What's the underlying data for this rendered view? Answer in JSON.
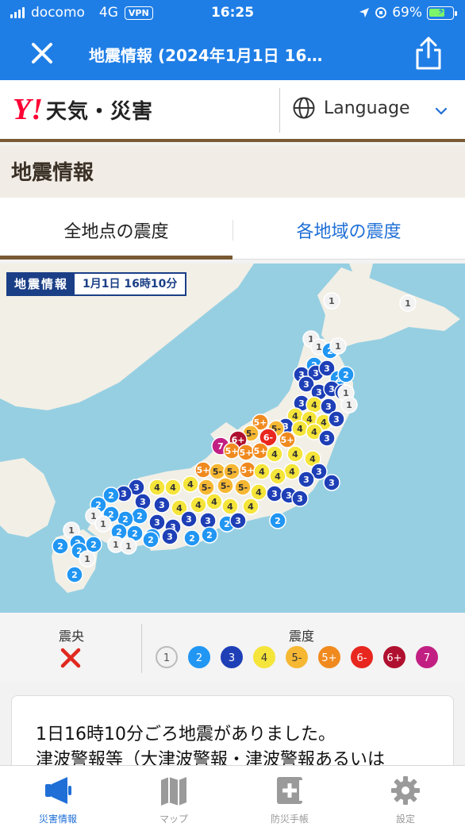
{
  "status_bar": {
    "carrier": "docomo",
    "network": "4G",
    "vpn": "VPN",
    "time": "16:25",
    "battery": "69%",
    "battery_level": 0.69
  },
  "navbar": {
    "title": "地震情報 (2024年1月1日 16…"
  },
  "brand": {
    "logo_mark": "Y!",
    "name": "天気・災害",
    "language_label": "Language"
  },
  "page": {
    "heading": "地震情報"
  },
  "tabs": [
    {
      "label": "全地点の震度",
      "active": true
    },
    {
      "label": "各地域の震度",
      "active": false
    }
  ],
  "map": {
    "badge_label": "地震情報",
    "badge_datetime": "1月1日 16時10分",
    "colors": {
      "sea": "#96cfe2",
      "land": "#f2efe6"
    }
  },
  "legend": {
    "epicenter_title": "震央",
    "intensity_title": "震度",
    "levels": [
      {
        "label": "1",
        "bg": "#f2f2f2",
        "fg": "#555555",
        "border": "#bbbbbb"
      },
      {
        "label": "2",
        "bg": "#2196f3",
        "fg": "#ffffff",
        "border": "#2196f3"
      },
      {
        "label": "3",
        "bg": "#1e3fb6",
        "fg": "#ffffff",
        "border": "#1e3fb6"
      },
      {
        "label": "4",
        "bg": "#f5e43a",
        "fg": "#333333",
        "border": "#f5e43a"
      },
      {
        "label": "5-",
        "bg": "#f6b733",
        "fg": "#333333",
        "border": "#f6b733"
      },
      {
        "label": "5+",
        "bg": "#f08a1f",
        "fg": "#ffffff",
        "border": "#f08a1f"
      },
      {
        "label": "6-",
        "bg": "#e8271f",
        "fg": "#ffffff",
        "border": "#e8271f"
      },
      {
        "label": "6+",
        "bg": "#b0102f",
        "fg": "#ffffff",
        "border": "#b0102f"
      },
      {
        "label": "7",
        "bg": "#c21f83",
        "fg": "#ffffff",
        "border": "#c21f83"
      }
    ]
  },
  "summary": {
    "line1": "1日16時10分ごろ地震がありました。",
    "line2": "津波警報等（大津波警報・津波警報あるいは"
  },
  "tab_bar": [
    {
      "label": "災害情報",
      "icon": "megaphone-icon",
      "active": true
    },
    {
      "label": "マップ",
      "icon": "map-icon",
      "active": false
    },
    {
      "label": "防災手帳",
      "icon": "first-aid-book-icon",
      "active": false
    },
    {
      "label": "設定",
      "icon": "gear-icon",
      "active": false
    }
  ]
}
